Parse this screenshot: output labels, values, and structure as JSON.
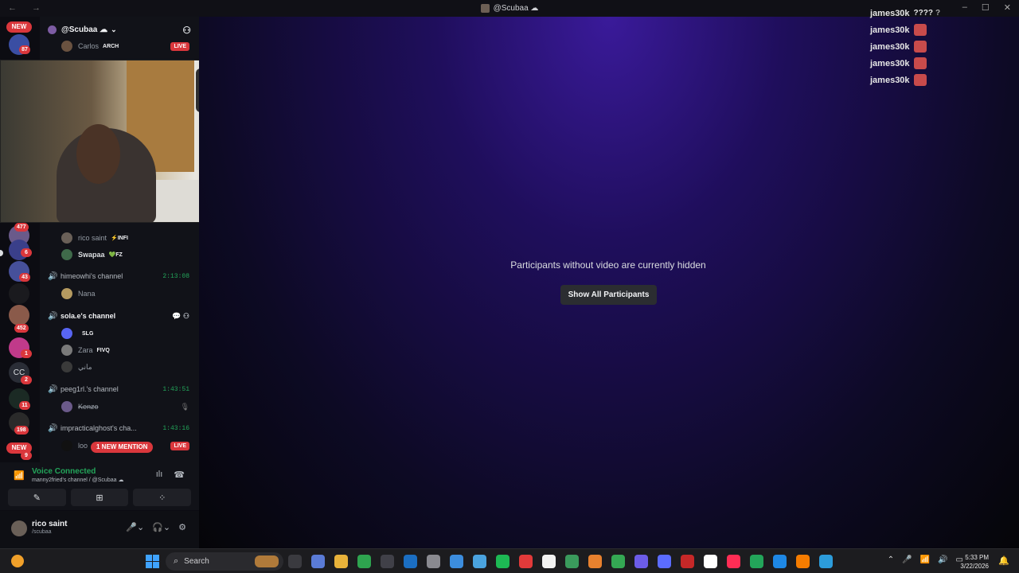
{
  "window": {
    "title": "@Scubaa ☁",
    "controls": [
      "–",
      "☐",
      "✕"
    ],
    "nav": "← →"
  },
  "server": {
    "name": "@Scubaa ☁",
    "caret": "⌄"
  },
  "rail": {
    "new_label": "NEW",
    "badges": [
      "87",
      "477",
      "6",
      "43",
      "452",
      "1",
      "2",
      "11",
      "198",
      "9"
    ],
    "cc_label": "CC"
  },
  "channels": {
    "top_user": {
      "name": "Carlos",
      "tag": "ARCH",
      "live": "LIVE"
    },
    "pre_users": [
      {
        "name": "rico saint",
        "tag": "⚡INFI"
      },
      {
        "name": "Swapaa",
        "tag": "💚FZ"
      }
    ],
    "list": [
      {
        "name": "himeowhi's channel",
        "time": "2:13:08",
        "users": [
          {
            "name": "Nana",
            "tag": ""
          }
        ]
      },
      {
        "name": "sola.e's channel",
        "time": "",
        "users": [
          {
            "name": "",
            "tag": "SLG"
          },
          {
            "name": "Zara",
            "tag": "FIVQ"
          },
          {
            "name": "ماني",
            "tag": ""
          }
        ]
      },
      {
        "name": "peeg1rl.'s channel",
        "time": "1:43:51",
        "users": [
          {
            "name": "Kenzo",
            "tag": ""
          }
        ]
      },
      {
        "name": "impracticalghost's cha...",
        "time": "1:43:16",
        "users": [
          {
            "name": "loo",
            "tag": ""
          }
        ]
      }
    ],
    "mention_pill": "1 NEW MENTION",
    "live_label": "LIVE"
  },
  "voice": {
    "status": "Voice Connected",
    "channel": "manny2fried's channel / @Scubaa ☁"
  },
  "user": {
    "name": "rico saint",
    "status": "/scubaa"
  },
  "stage": {
    "message": "Participants without video are currently hidden",
    "button": "Show All Participants"
  },
  "alerts": [
    {
      "user": "james30k",
      "extra": "????"
    },
    {
      "user": "james30k",
      "extra": ""
    },
    {
      "user": "james30k",
      "extra": ""
    },
    {
      "user": "james30k",
      "extra": ""
    },
    {
      "user": "james30k",
      "extra": ""
    }
  ],
  "taskbar": {
    "search_label": "Search",
    "time": "5:33 PM",
    "date": "3/22/2026",
    "app_colors": [
      "#3a3a3f",
      "#5a7bd6",
      "#e8b23a",
      "#2ea44f",
      "#404048",
      "#1b6ec2",
      "#8a8a90",
      "#3c8dde",
      "#4aa3df",
      "#1db954",
      "#e23a3a",
      "#f2f2f2",
      "#3a9a5c",
      "#e8812e",
      "#34a853",
      "#6c5ce7",
      "#5b6cff",
      "#c62828",
      "#ffffff",
      "#ff2d55",
      "#23a55a",
      "#1e88e5",
      "#f57c00",
      "#2c9cdb"
    ]
  },
  "colors": {
    "accent_green": "#23a55a",
    "live_red": "#da373c",
    "stage_purple": "#3a1a9a"
  }
}
